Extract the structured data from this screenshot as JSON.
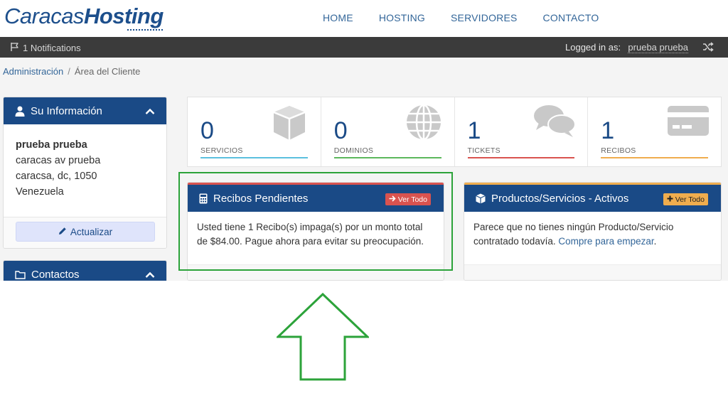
{
  "logo": {
    "part1": "Caracas",
    "part2": "Hosting"
  },
  "nav": [
    "HOME",
    "HOSTING",
    "SERVIDORES",
    "CONTACTO"
  ],
  "topbar": {
    "notifications": "1 Notifications",
    "logged_in_label": "Logged in as:",
    "user": "prueba prueba"
  },
  "breadcrumb": {
    "home": "Administración",
    "separator": "/",
    "current": "Área del Cliente"
  },
  "sidebar": {
    "info": {
      "title": "Su Información",
      "name": "prueba prueba",
      "address1": "caracas av prueba",
      "address2": "caracsa, dc, 1050",
      "country": "Venezuela",
      "button": "Actualizar"
    },
    "contacts": {
      "title": "Contactos"
    }
  },
  "stats": [
    {
      "count": "0",
      "label": "SERVICIOS",
      "color": "#5bc0de",
      "icon": "cube-icon"
    },
    {
      "count": "0",
      "label": "DOMINIOS",
      "color": "#5cb85c",
      "icon": "globe-icon"
    },
    {
      "count": "1",
      "label": "TICKETS",
      "color": "#d9534f",
      "icon": "comments-icon"
    },
    {
      "count": "1",
      "label": "RECIBOS",
      "color": "#f0ad4e",
      "icon": "credit-card-icon"
    }
  ],
  "invoices_panel": {
    "title": "Recibos Pendientes",
    "button": "Ver Todo",
    "body": "Usted tiene 1 Recibo(s) impaga(s) por un monto total de $84.00. Pague ahora para evitar su preocupación.",
    "accent": "#d9534f"
  },
  "products_panel": {
    "title": "Productos/Servicios - Activos",
    "button": "Ver Todo",
    "body": "Parece que no tienes ningún Producto/Servicio contratado todavía. ",
    "link": "Compre para empezar",
    "after_link": ".",
    "accent": "#f0ad4e"
  },
  "colors": {
    "brand": "#1a4a86",
    "annotation": "#2ca33a"
  }
}
